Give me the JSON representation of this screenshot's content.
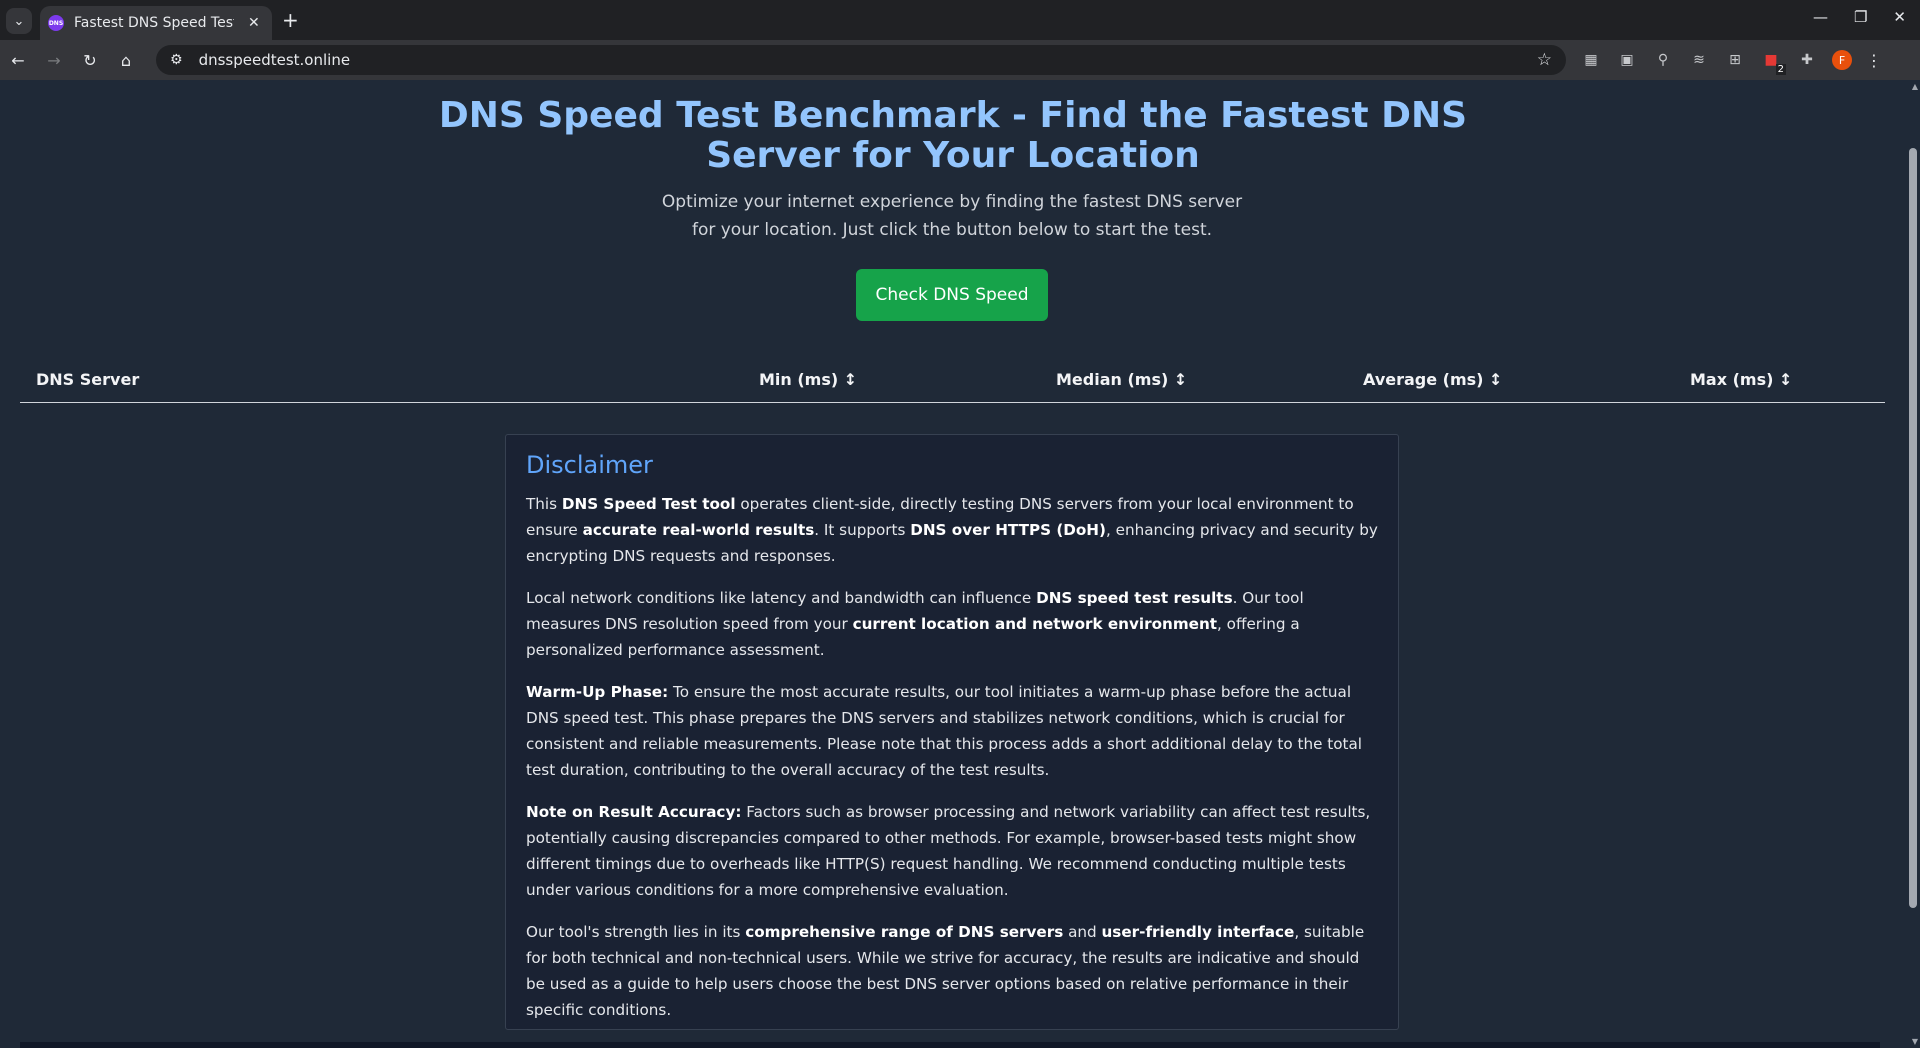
{
  "browser": {
    "tab_title": "Fastest DNS Speed Test",
    "favicon_text": "DNS",
    "url": "dnsspeedtest.online",
    "profile_initial": "F",
    "extension_badge": "2"
  },
  "hero": {
    "title": "DNS Speed Test Benchmark - Find the Fastest DNS Server for Your Location",
    "subtitle": "Optimize your internet experience by finding the fastest DNS server for your location. Just click the button below to start the test.",
    "cta_label": "Check DNS Speed"
  },
  "results_table": {
    "columns": [
      "DNS Server",
      "Min (ms) ↕",
      "Median (ms) ↕",
      "Average (ms) ↕",
      "Max (ms) ↕"
    ]
  },
  "disclaimer": {
    "heading": "Disclaimer",
    "p1": {
      "a": "This ",
      "b1": "DNS Speed Test tool",
      "c": " operates client-side, directly testing DNS servers from your local environment to ensure ",
      "b2": "accurate real-world results",
      "d": ". It supports ",
      "b3": "DNS over HTTPS (DoH)",
      "e": ", enhancing privacy and security by encrypting DNS requests and responses."
    },
    "p2": {
      "a": "Local network conditions like latency and bandwidth can influence ",
      "b1": "DNS speed test results",
      "c": ". Our tool measures DNS resolution speed from your ",
      "b2": "current location and network environment",
      "d": ", offering a personalized performance assessment."
    },
    "p3": {
      "b1": "Warm-Up Phase:",
      "a": " To ensure the most accurate results, our tool initiates a warm-up phase before the actual DNS speed test. This phase prepares the DNS servers and stabilizes network conditions, which is crucial for consistent and reliable measurements. Please note that this process adds a short additional delay to the total test duration, contributing to the overall accuracy of the test results."
    },
    "p4": {
      "b1": "Note on Result Accuracy:",
      "a": " Factors such as browser processing and network variability can affect test results, potentially causing discrepancies compared to other methods. For example, browser-based tests might show different timings due to overheads like HTTP(S) request handling. We recommend conducting multiple tests under various conditions for a more comprehensive evaluation."
    },
    "p5": {
      "a": "Our tool's strength lies in its ",
      "b1": "comprehensive range of DNS servers",
      "c": " and ",
      "b2": "user-friendly interface",
      "d": ", suitable for both technical and non-technical users. While we strive for accuracy, the results are indicative and should be used as a guide to help users choose the best DNS server options based on relative performance in their specific conditions."
    }
  }
}
